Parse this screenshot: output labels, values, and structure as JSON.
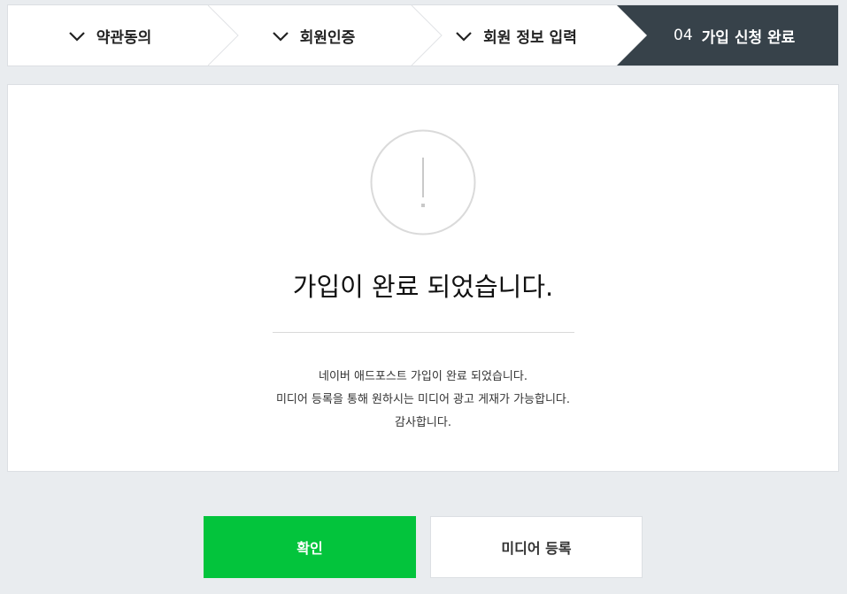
{
  "steps": [
    {
      "label": "약관동의",
      "done": true
    },
    {
      "label": "회원인증",
      "done": true
    },
    {
      "label": "회원 정보 입력",
      "done": true
    },
    {
      "num": "04",
      "label": "가입 신청 완료",
      "active": true
    }
  ],
  "main": {
    "headline": "가입이 완료 되었습니다.",
    "messages": [
      "네이버 애드포스트 가입이 완료 되었습니다.",
      "미디어 등록을 통해 원하시는 미디어 광고 게재가 가능합니다.",
      "감사합니다."
    ]
  },
  "buttons": {
    "confirm": "확인",
    "media_register": "미디어 등록"
  },
  "colors": {
    "active_step_bg": "#37424a",
    "confirm_bg": "#03c43c",
    "page_bg": "#e9ecef"
  }
}
